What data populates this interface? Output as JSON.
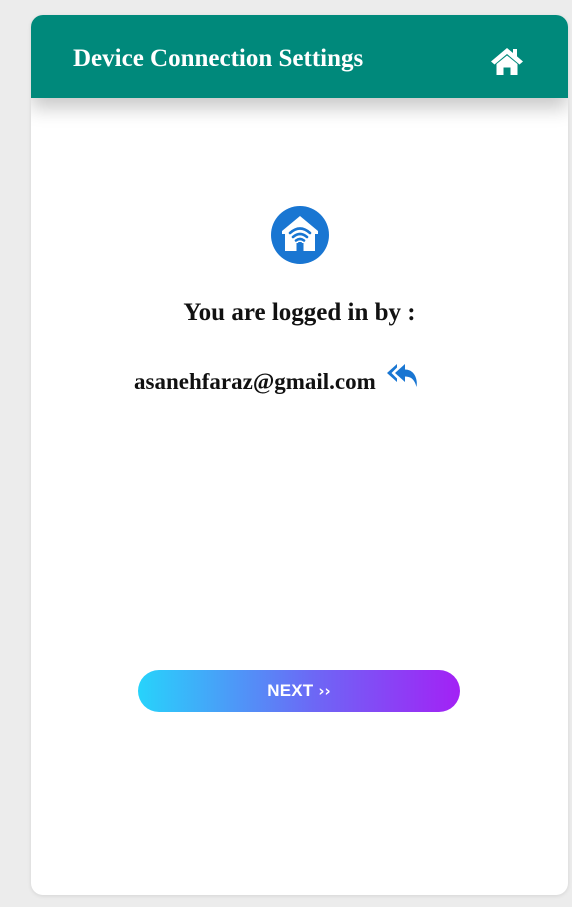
{
  "header": {
    "title": "Device Connection Settings",
    "home_icon": "home-icon",
    "background_color": "#00897b"
  },
  "main": {
    "status_icon": "wifi-home-icon",
    "logged_in_label": "You are logged in by :",
    "email": "asanehfaraz@gmail.com",
    "switch_account_icon": "reply-all-icon",
    "accent_color": "#1976d2"
  },
  "footer": {
    "next_label": "NEXT",
    "next_chevron": "››",
    "gradient_start": "#27d3fb",
    "gradient_end": "#a321f5"
  }
}
